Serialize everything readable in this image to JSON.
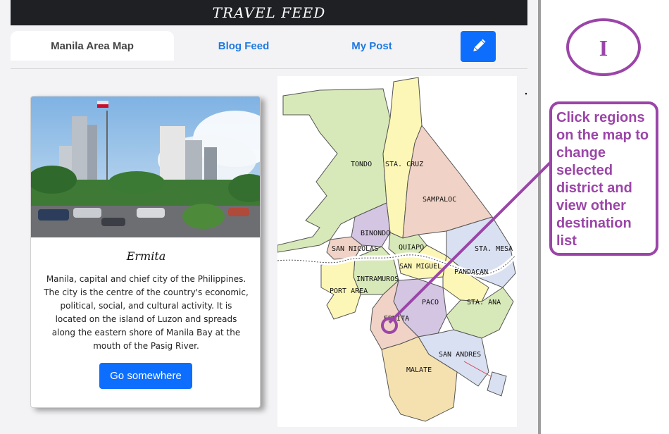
{
  "header": {
    "title": "TRAVEL FEED"
  },
  "tabs": [
    {
      "label": "Manila Area Map",
      "active": true
    },
    {
      "label": "Blog Feed",
      "active": false
    },
    {
      "label": "My Post",
      "active": false
    }
  ],
  "edit_button": {
    "icon": "pencil-icon"
  },
  "card": {
    "title": "Ermita",
    "description": "Manila, capital and chief city of the Philippines. The city is the centre of the country's economic, political, social, and cultural activity. It is located on the island of Luzon and spreads along the eastern shore of Manila Bay at the mouth of the Pasig River.",
    "button_label": "Go somewhere"
  },
  "map": {
    "districts": [
      "TONDO",
      "STA. CRUZ",
      "SAMPALOC",
      "BINONDO",
      "SAN NICOLAS",
      "QUIAPO",
      "STA. MESA",
      "SAN MIGUEL",
      "PANDACAN",
      "INTRAMUROS",
      "PORT AREA",
      "PACO",
      "STA. ANA",
      "ERMITA",
      "SAN ANDRES",
      "MALATE"
    ],
    "selected": "ERMITA"
  },
  "annotation": {
    "step": "I",
    "callout": "Click regions on the map to change selected district and view other destination list",
    "color": "#9b45a8"
  }
}
